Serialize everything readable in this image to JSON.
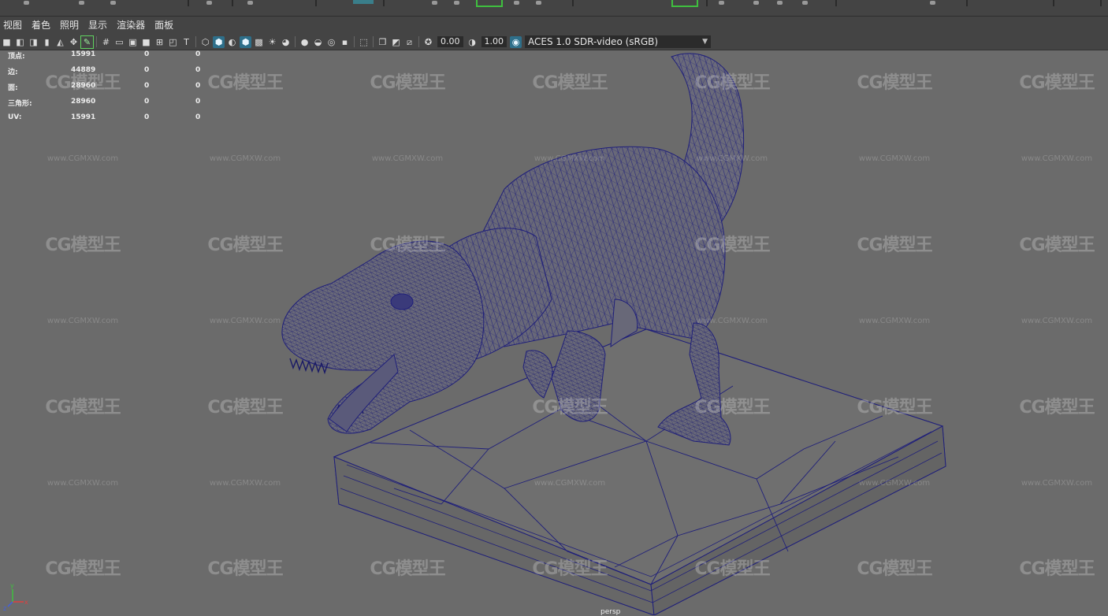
{
  "menu": {
    "items": [
      {
        "label": "视图"
      },
      {
        "label": "着色"
      },
      {
        "label": "照明"
      },
      {
        "label": "显示"
      },
      {
        "label": "渲染器"
      },
      {
        "label": "面板"
      }
    ]
  },
  "toolbar": {
    "exposure_value": "0.00",
    "gamma_value": "1.00",
    "color_management": "ACES 1.0 SDR-video (sRGB)",
    "accent_color": "#2e6f8a"
  },
  "hud": {
    "rows": [
      {
        "label": "顶点:",
        "value": "15991",
        "sel": "0",
        "comp": "0"
      },
      {
        "label": "边:",
        "value": "44889",
        "sel": "0",
        "comp": "0"
      },
      {
        "label": "面:",
        "value": "28960",
        "sel": "0",
        "comp": "0"
      },
      {
        "label": "三角形:",
        "value": "28960",
        "sel": "0",
        "comp": "0"
      },
      {
        "label": "UV:",
        "value": "15991",
        "sel": "0",
        "comp": "0"
      }
    ]
  },
  "viewport": {
    "camera": "persp",
    "wireframe_color": "#1f1f7a",
    "background": "#6b6b6b"
  },
  "watermark": {
    "logo": "CG模型王",
    "url": "www.CGMXW.com"
  },
  "axis": {
    "x": "x",
    "y": "y",
    "z": "z"
  }
}
